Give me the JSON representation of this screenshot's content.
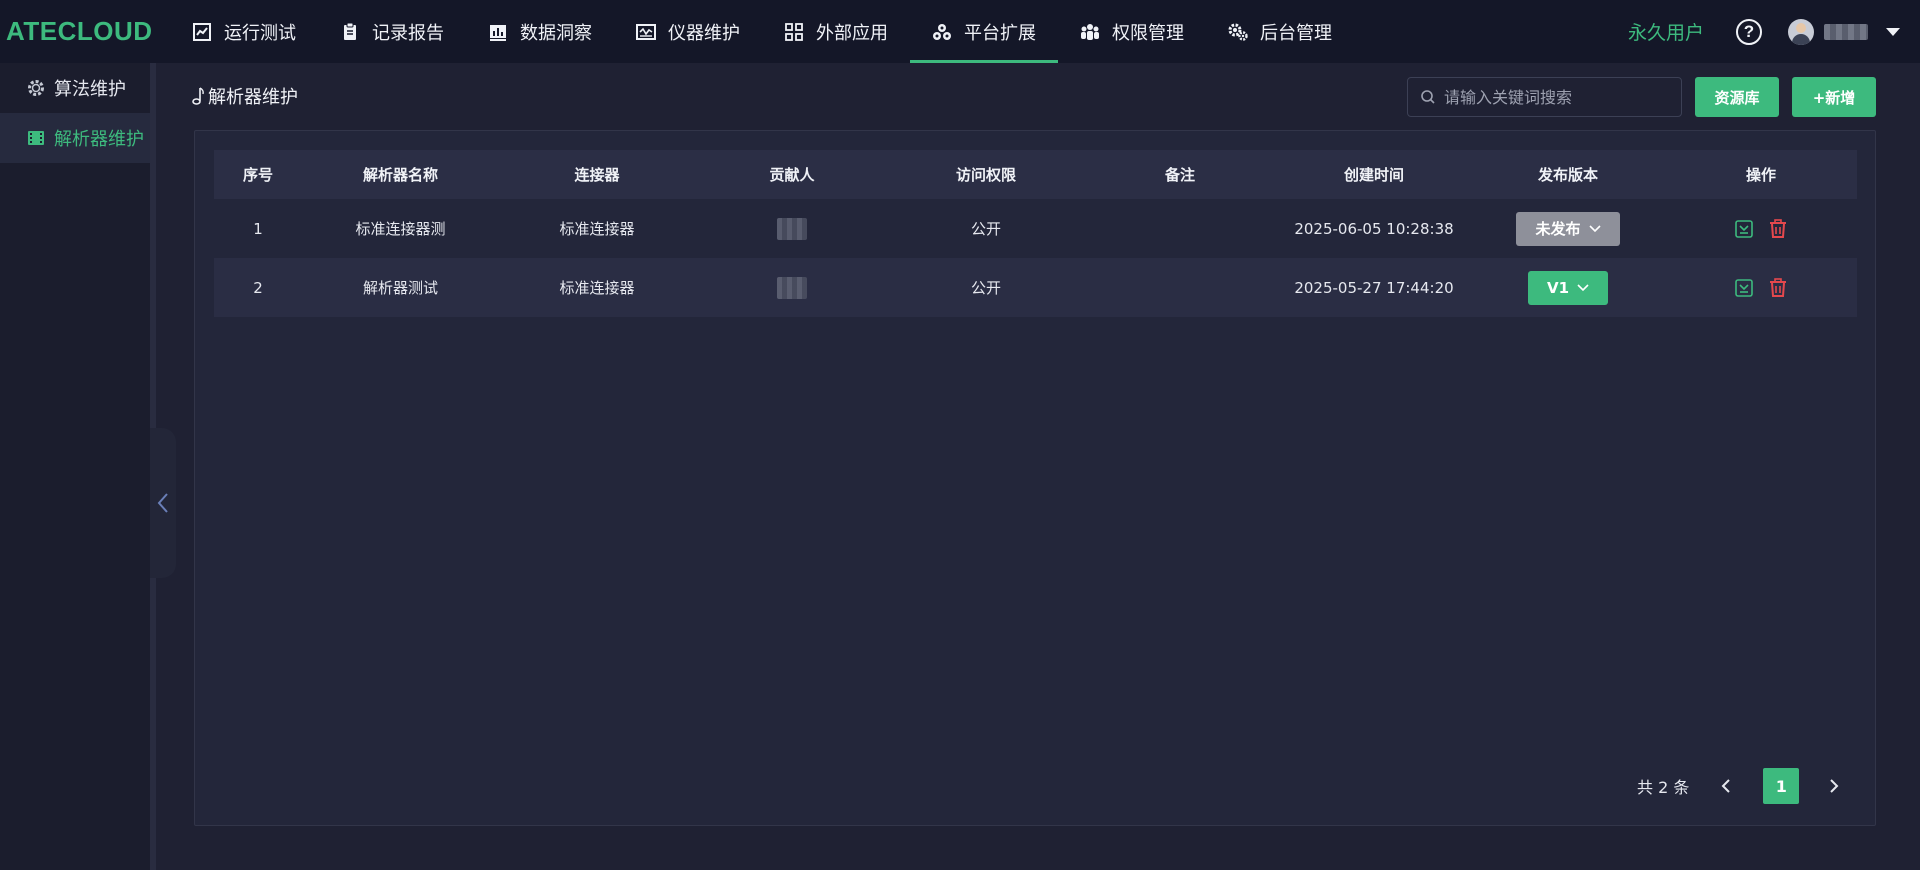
{
  "app": {
    "logo": "ATECLOUD"
  },
  "nav": {
    "items": [
      {
        "label": "运行测试",
        "icon": "chart-line-icon"
      },
      {
        "label": "记录报告",
        "icon": "clipboard-icon"
      },
      {
        "label": "数据洞察",
        "icon": "bar-chart-icon"
      },
      {
        "label": "仪器维护",
        "icon": "waveform-icon"
      },
      {
        "label": "外部应用",
        "icon": "grid-icon"
      },
      {
        "label": "平台扩展",
        "icon": "cluster-icon",
        "active": true
      },
      {
        "label": "权限管理",
        "icon": "users-icon"
      },
      {
        "label": "后台管理",
        "icon": "gears-icon"
      }
    ],
    "user_type": "永久用户",
    "help": "?"
  },
  "sidebar": {
    "items": [
      {
        "label": "算法维护",
        "icon": "gear-icon"
      },
      {
        "label": "解析器维护",
        "icon": "film-icon",
        "active": true
      }
    ]
  },
  "page": {
    "title": "解析器维护",
    "search_placeholder": "请输入关键词搜索",
    "resource_button": "资源库",
    "add_button": "+新增"
  },
  "table": {
    "columns": [
      "序号",
      "解析器名称",
      "连接器",
      "贡献人",
      "访问权限",
      "备注",
      "创建时间",
      "发布版本",
      "操作"
    ],
    "rows": [
      {
        "index": "1",
        "name": "标准连接器测",
        "connector": "标准连接器",
        "contributor": "",
        "access": "公开",
        "remark": "",
        "created": "2025-06-05 10:28:38",
        "version": "未发布"
      },
      {
        "index": "2",
        "name": "解析器测试",
        "connector": "标准连接器",
        "contributor": "",
        "access": "公开",
        "remark": "",
        "created": "2025-05-27 17:44:20",
        "version": "V1"
      }
    ]
  },
  "pagination": {
    "total": "共 2 条",
    "current": "1"
  },
  "colors": {
    "accent": "#3dba7e",
    "danger": "#e5484d",
    "unpublished": "#8e909a"
  }
}
